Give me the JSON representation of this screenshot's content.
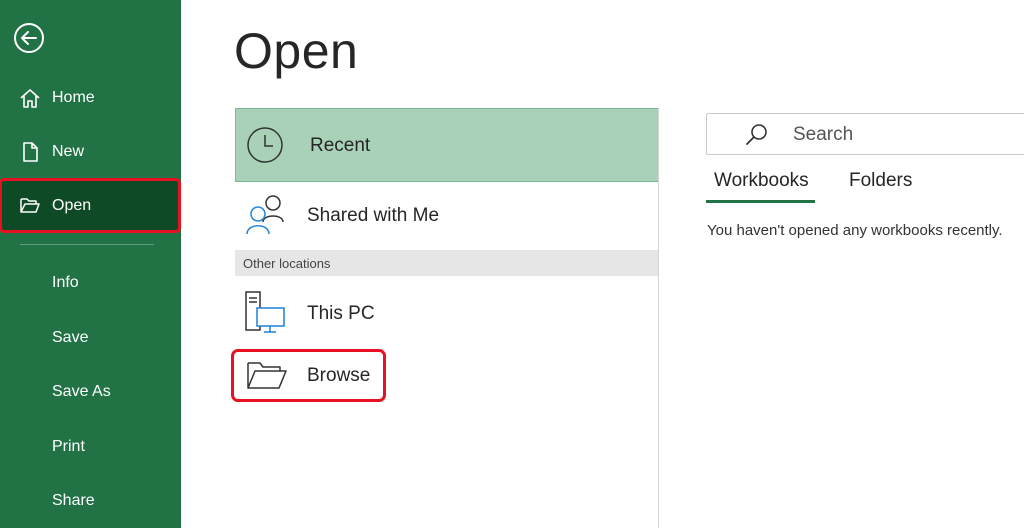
{
  "sidebar": {
    "back_icon": "back-arrow-icon",
    "items": [
      {
        "label": "Home",
        "icon": "home-icon"
      },
      {
        "label": "New",
        "icon": "new-document-icon"
      },
      {
        "label": "Open",
        "icon": "open-folder-icon"
      },
      {
        "label": "Info"
      },
      {
        "label": "Save"
      },
      {
        "label": "Save As"
      },
      {
        "label": "Print"
      },
      {
        "label": "Share"
      }
    ],
    "selected": "Open"
  },
  "main": {
    "title": "Open",
    "locations": {
      "recent": {
        "label": "Recent",
        "icon": "clock-icon"
      },
      "shared": {
        "label": "Shared with Me",
        "icon": "people-icon"
      },
      "other_header": "Other locations",
      "this_pc": {
        "label": "This PC",
        "icon": "computer-icon"
      },
      "browse": {
        "label": "Browse",
        "icon": "folder-icon"
      }
    }
  },
  "right": {
    "search": {
      "placeholder": "Search",
      "value": ""
    },
    "tabs": [
      {
        "label": "Workbooks",
        "selected": true
      },
      {
        "label": "Folders",
        "selected": false
      }
    ],
    "empty_message": "You haven't opened any workbooks recently."
  },
  "colors": {
    "sidebar_bg": "#217346",
    "selected_bg": "#0e4a26",
    "recent_highlight": "#a9d1b7",
    "annotation_red": "#e81123"
  }
}
